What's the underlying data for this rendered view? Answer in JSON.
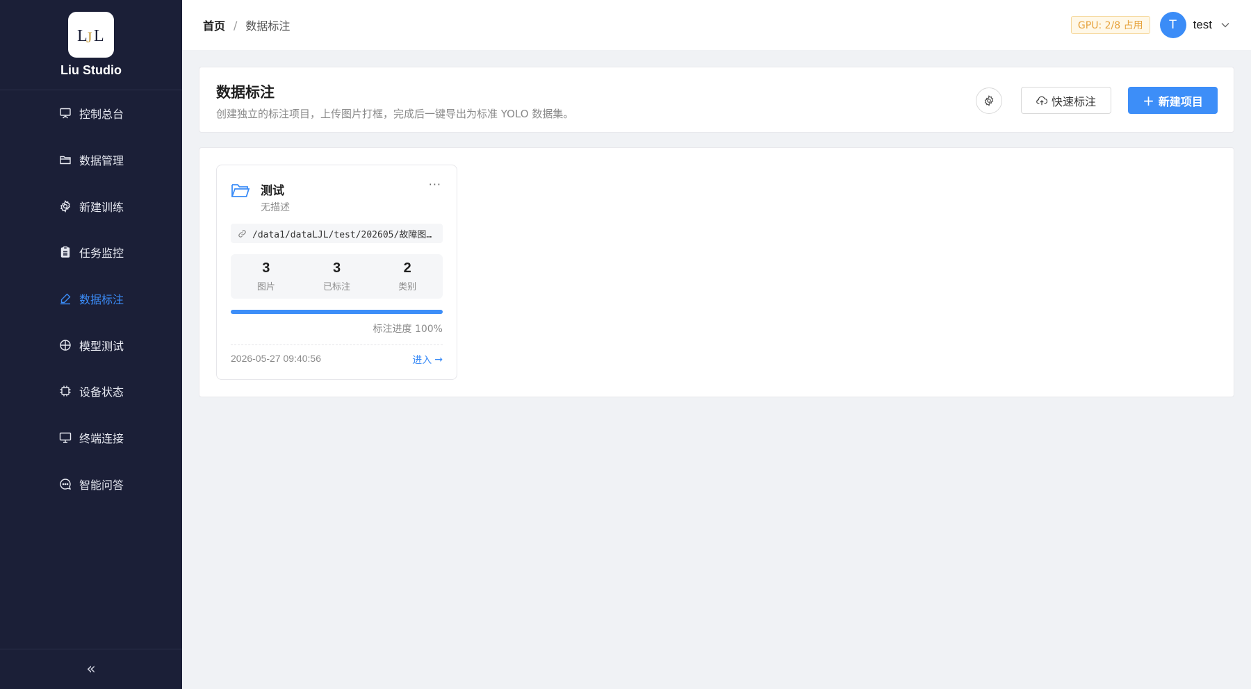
{
  "sidebar": {
    "brand": "Liu Studio",
    "logo_text": "LJL",
    "items": [
      {
        "label": "控制总台",
        "icon": "presentation-icon"
      },
      {
        "label": "数据管理",
        "icon": "folder-icon"
      },
      {
        "label": "新建训练",
        "icon": "gear-icon"
      },
      {
        "label": "任务监控",
        "icon": "clipboard-icon"
      },
      {
        "label": "数据标注",
        "icon": "pen-icon",
        "active": true
      },
      {
        "label": "模型测试",
        "icon": "aperture-icon"
      },
      {
        "label": "设备状态",
        "icon": "chip-icon"
      },
      {
        "label": "终端连接",
        "icon": "monitor-icon"
      },
      {
        "label": "智能问答",
        "icon": "chat-icon"
      }
    ],
    "collapse": "«"
  },
  "header": {
    "breadcrumb_home": "首页",
    "breadcrumb_sep": "/",
    "breadcrumb_current": "数据标注",
    "gpu_badge": "GPU: 2/8 占用",
    "avatar_letter": "T",
    "username": "test"
  },
  "page": {
    "title": "数据标注",
    "description": "创建独立的标注项目，上传图片打框，完成后一键导出为标准 YOLO 数据集。",
    "quick_label": "快速标注",
    "new_label": "新建项目",
    "new_plus": "+"
  },
  "project_card": {
    "name": "测试",
    "description": "无描述",
    "more": "···",
    "path": "/data1/dataLJL/test/202605/故障图…",
    "stats": [
      {
        "value": "3",
        "label": "图片"
      },
      {
        "value": "3",
        "label": "已标注"
      },
      {
        "value": "2",
        "label": "类别"
      }
    ],
    "progress": 1.0,
    "progress_label": "标注进度 100%",
    "date": "2026-05-27 09:40:56",
    "enter_label": "进入",
    "enter_arrow": "→"
  },
  "colors": {
    "sidebar_bg": "#1b1f37",
    "accent": "#3d8ef8",
    "gpu_text": "#e6a23c"
  }
}
